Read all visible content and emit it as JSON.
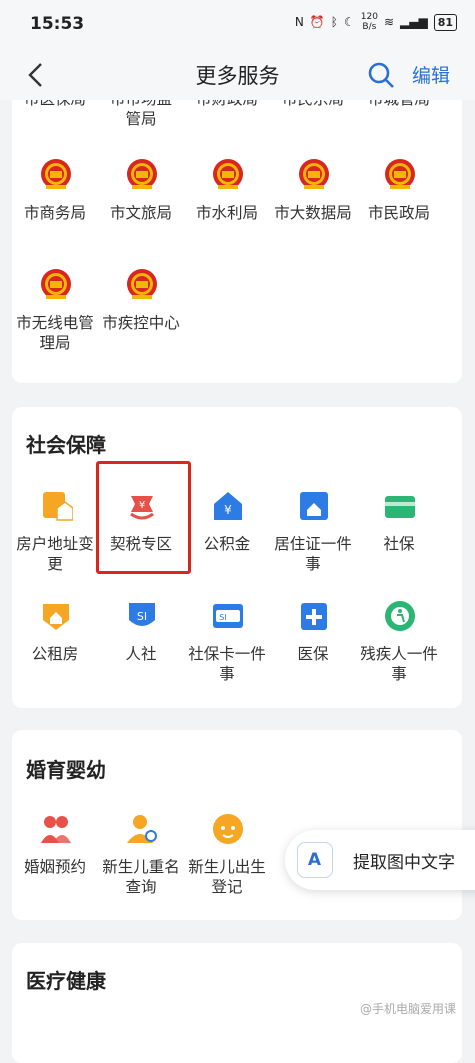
{
  "status_bar": {
    "time": "15:53",
    "speed": "120\nB/s",
    "battery": "81"
  },
  "nav": {
    "title": "更多服务",
    "edit": "编辑"
  },
  "gov_section": {
    "partial_items": [
      "市医保局",
      "市市场监管局",
      "市财政局",
      "市民宗局",
      "市城管局"
    ],
    "items": [
      {
        "label": "市商务局",
        "icon": "national-emblem-icon"
      },
      {
        "label": "市文旅局",
        "icon": "national-emblem-icon"
      },
      {
        "label": "市水利局",
        "icon": "national-emblem-icon"
      },
      {
        "label": "市大数据局",
        "icon": "national-emblem-icon"
      },
      {
        "label": "市民政局",
        "icon": "national-emblem-icon"
      },
      {
        "label": "市无线电管理局",
        "icon": "national-emblem-icon"
      },
      {
        "label": "市疾控中心",
        "icon": "national-emblem-icon"
      }
    ]
  },
  "social_section": {
    "title": "社会保障",
    "items": [
      {
        "label": "房户地址变更",
        "icon": "house-address-icon",
        "color": "#f5a623"
      },
      {
        "label": "契税专区",
        "icon": "deed-tax-icon",
        "color": "#e8504a"
      },
      {
        "label": "公积金",
        "icon": "housing-fund-icon",
        "color": "#2d7be5"
      },
      {
        "label": "居住证一件事",
        "icon": "residence-permit-icon",
        "color": "#2d7be5"
      },
      {
        "label": "社保",
        "icon": "social-security-card-icon",
        "color": "#2bb673"
      },
      {
        "label": "公租房",
        "icon": "public-housing-icon",
        "color": "#f5a623"
      },
      {
        "label": "人社",
        "icon": "hr-social-icon",
        "color": "#2d7be5"
      },
      {
        "label": "社保卡一件事",
        "icon": "si-card-icon",
        "color": "#2d7be5"
      },
      {
        "label": "医保",
        "icon": "medical-insurance-icon",
        "color": "#2d7be5"
      },
      {
        "label": "残疾人一件事",
        "icon": "disabled-person-icon",
        "color": "#2bb673"
      }
    ]
  },
  "marriage_section": {
    "title": "婚育婴幼",
    "items": [
      {
        "label": "婚姻预约",
        "icon": "couple-icon",
        "color": "#e8504a"
      },
      {
        "label": "新生儿重名查询",
        "icon": "newborn-search-icon",
        "color": "#f5a623"
      },
      {
        "label": "新生儿出生登记",
        "icon": "baby-face-icon",
        "color": "#f5a623"
      }
    ]
  },
  "medical_section": {
    "title": "医疗健康"
  },
  "ocr_button": {
    "label": "提取图中文字",
    "icon_letter": "A"
  },
  "watermark": "@手机电脑爱用课"
}
